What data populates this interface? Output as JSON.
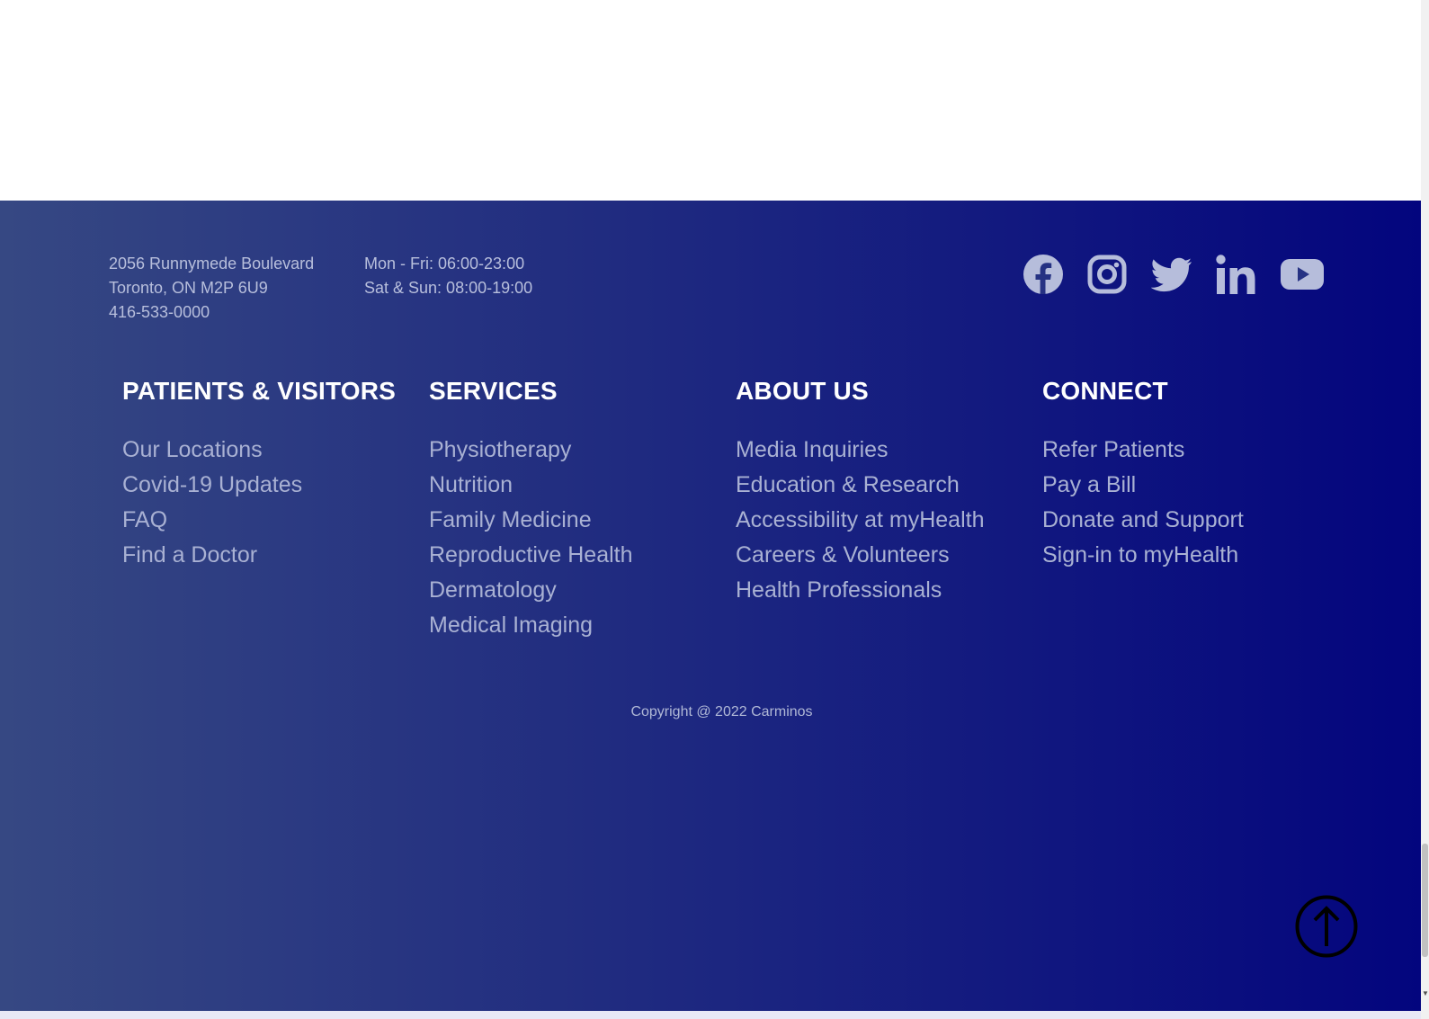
{
  "contact": {
    "address_line1": "2056 Runnymede Boulevard",
    "address_line2": "Toronto, ON M2P 6U9",
    "phone": "416-533-0000",
    "hours_weekday": "Mon - Fri: 06:00-23:00",
    "hours_weekend": "Sat & Sun: 08:00-19:00"
  },
  "social": {
    "icons": [
      "facebook-icon",
      "instagram-icon",
      "twitter-icon",
      "linkedin-icon",
      "youtube-icon"
    ],
    "icon_color": "#b6bddb"
  },
  "columns": [
    {
      "heading": "PATIENTS & VISITORS",
      "links": [
        "Our Locations",
        "Covid-19 Updates",
        "FAQ",
        "Find a Doctor"
      ]
    },
    {
      "heading": "SERVICES",
      "links": [
        "Physiotherapy",
        "Nutrition",
        "Family Medicine",
        "Reproductive Health",
        "Dermatology",
        "Medical Imaging"
      ]
    },
    {
      "heading": "ABOUT US",
      "links": [
        "Media Inquiries",
        "Education & Research",
        "Accessibility at myHealth",
        "Careers & Volunteers",
        "Health Professionals"
      ]
    },
    {
      "heading": "CONNECT",
      "links": [
        "Refer Patients",
        "Pay a Bill",
        "Donate and Support",
        "Sign-in to myHealth"
      ]
    }
  ],
  "copyright": "Copyright @ 2022 Carminos",
  "back_to_top": {
    "icon": "arrow-up-icon"
  },
  "colors": {
    "gradient_start": "#364883",
    "gradient_end": "#03057e",
    "heading": "#ffffff",
    "link": "#a9b1d3"
  }
}
